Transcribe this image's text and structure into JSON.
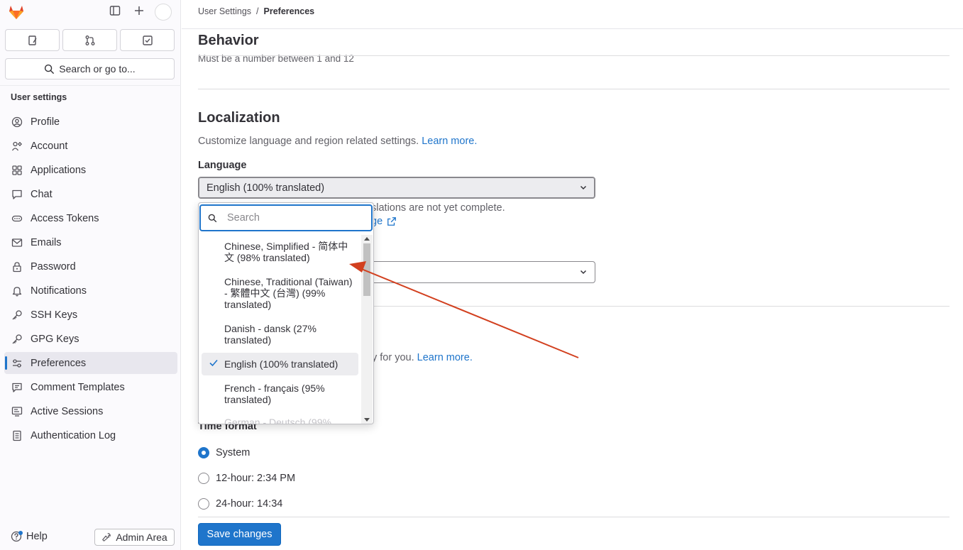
{
  "sidebar": {
    "title": "User settings",
    "search_label": "Search or go to...",
    "items": [
      {
        "label": "Profile",
        "icon": "profile-icon"
      },
      {
        "label": "Account",
        "icon": "account-icon"
      },
      {
        "label": "Applications",
        "icon": "applications-icon"
      },
      {
        "label": "Chat",
        "icon": "chat-icon"
      },
      {
        "label": "Access Tokens",
        "icon": "token-icon"
      },
      {
        "label": "Emails",
        "icon": "mail-icon"
      },
      {
        "label": "Password",
        "icon": "lock-icon"
      },
      {
        "label": "Notifications",
        "icon": "bell-icon"
      },
      {
        "label": "SSH Keys",
        "icon": "key-icon"
      },
      {
        "label": "GPG Keys",
        "icon": "key-icon"
      },
      {
        "label": "Preferences",
        "icon": "preferences-icon",
        "active": true
      },
      {
        "label": "Comment Templates",
        "icon": "comment-icon"
      },
      {
        "label": "Active Sessions",
        "icon": "monitor-icon"
      },
      {
        "label": "Authentication Log",
        "icon": "log-icon"
      }
    ],
    "help_label": "Help",
    "admin_label": "Admin Area"
  },
  "breadcrumb": {
    "parent": "User Settings",
    "separator": "/",
    "current": "Preferences"
  },
  "behavior": {
    "title": "Behavior",
    "hint": "Must be a number between 1 and 12"
  },
  "localization": {
    "title": "Localization",
    "description": "Customize language and region related settings.",
    "learn_more": "Learn more.",
    "language_label": "Language",
    "language_value": "English (100% translated)",
    "partial_help": "slations are not yet complete.",
    "partial_link": "ge",
    "partial_text2": "y for you.",
    "partial_link2": "Learn more."
  },
  "dropdown": {
    "search_placeholder": "Search",
    "options": [
      {
        "label": "Chinese, Simplified - 简体中文 (98% translated)"
      },
      {
        "label": "Chinese, Traditional (Taiwan) - 繁體中文 (台灣) (99% translated)"
      },
      {
        "label": "Danish - dansk (27% translated)"
      },
      {
        "label": "English (100% translated)",
        "selected": true
      },
      {
        "label": "French - français (95% translated)"
      },
      {
        "label": "German - Deutsch (99%"
      }
    ]
  },
  "time_format": {
    "label": "Time format",
    "options": [
      {
        "label": "System",
        "checked": true
      },
      {
        "label": "12-hour: 2:34 PM",
        "checked": false
      },
      {
        "label": "24-hour: 14:34",
        "checked": false
      }
    ]
  },
  "save_label": "Save changes",
  "colors": {
    "accent": "#1f75cb",
    "annotation_arrow": "#d2401f",
    "logo": "#e24329"
  }
}
